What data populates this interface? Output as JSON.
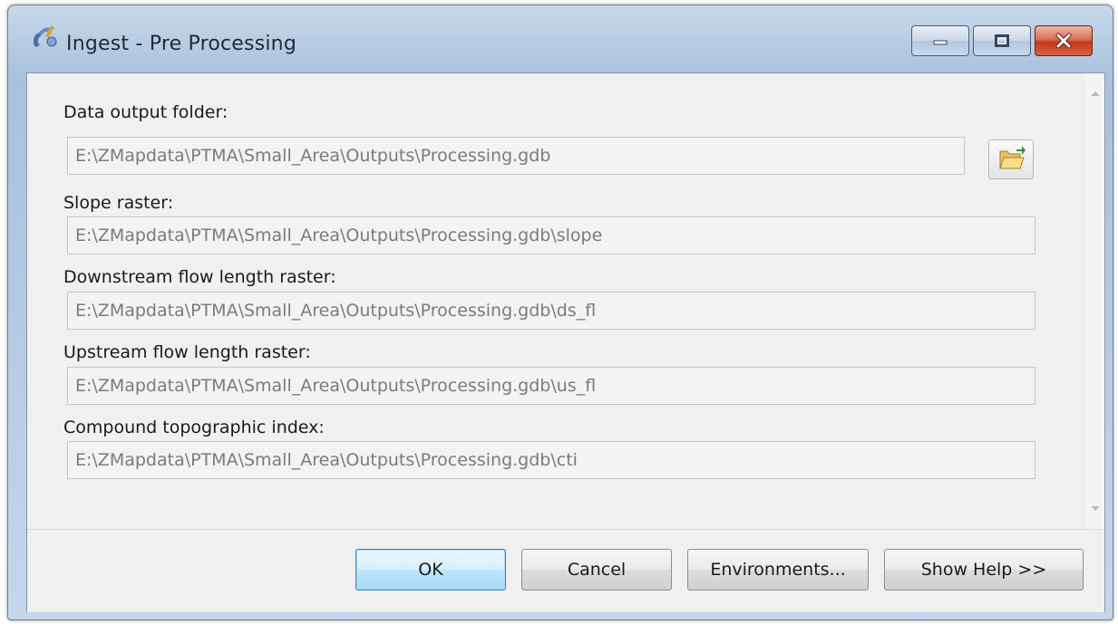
{
  "window": {
    "title": "Ingest - Pre Processing",
    "icon": "geoprocessing-tool-icon"
  },
  "caption_buttons": {
    "minimize": "minimize-icon",
    "maximize": "maximize-icon",
    "close": "close-icon"
  },
  "parameters": [
    {
      "label": "Data output folder:",
      "value": "E:\\ZMapdata\\PTMA\\Small_Area\\Outputs\\Processing.gdb",
      "has_browse": true
    },
    {
      "label": "Slope raster:",
      "value": "E:\\ZMapdata\\PTMA\\Small_Area\\Outputs\\Processing.gdb\\slope"
    },
    {
      "label": "Downstream flow length raster:",
      "value": "E:\\ZMapdata\\PTMA\\Small_Area\\Outputs\\Processing.gdb\\ds_fl"
    },
    {
      "label": "Upstream flow length raster:",
      "value": "E:\\ZMapdata\\PTMA\\Small_Area\\Outputs\\Processing.gdb\\us_fl"
    },
    {
      "label": "Compound topographic index:",
      "value": "E:\\ZMapdata\\PTMA\\Small_Area\\Outputs\\Processing.gdb\\cti"
    }
  ],
  "browse_icon": "open-folder-icon",
  "buttons": {
    "ok": "OK",
    "cancel": "Cancel",
    "environments": "Environments...",
    "show_help": "Show Help >>"
  },
  "colors": {
    "title_bar": "#b8cde4",
    "default_button_border": "#3c7fb1",
    "close_button": "#c0391c"
  }
}
